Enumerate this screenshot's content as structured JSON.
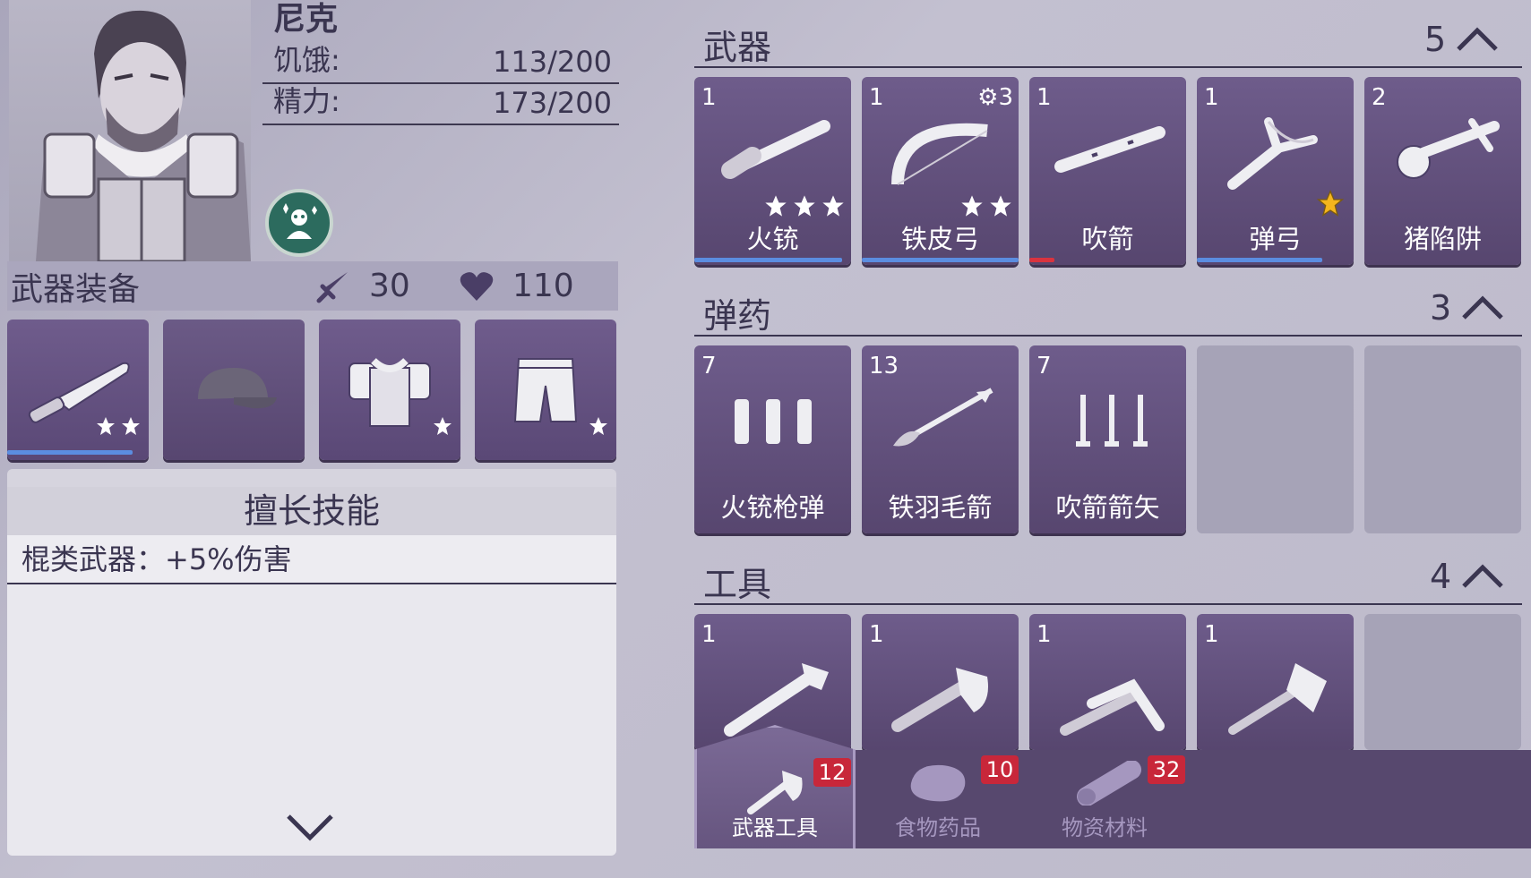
{
  "character": {
    "name": "尼克",
    "stats": [
      {
        "label": "饥饿:",
        "value": "113/200"
      },
      {
        "label": "精力:",
        "value": "173/200"
      }
    ],
    "perk_icon": "perk-badge-icon"
  },
  "equipment": {
    "title": "武器装备",
    "attack": "30",
    "health": "110",
    "slots": [
      {
        "icon": "machete-icon",
        "stars": 2,
        "durability": 0.9
      },
      {
        "icon": "cap-icon",
        "empty": true
      },
      {
        "icon": "armor-vest-icon",
        "stars": 1
      },
      {
        "icon": "shorts-icon",
        "stars": 1
      }
    ]
  },
  "skills": {
    "title": "擅长技能",
    "items": [
      "棍类武器：+5%伤害"
    ]
  },
  "inventory": {
    "sections": [
      {
        "title": "武器",
        "count": "5",
        "items": [
          {
            "qty": "1",
            "name": "火铳",
            "stars": 3,
            "durability": 0.95,
            "bar_color": "#5b8de0"
          },
          {
            "qty": "1",
            "name": "铁皮弓",
            "stars": 2,
            "gear": "3",
            "durability": 1.0,
            "bar_color": "#5b8de0"
          },
          {
            "qty": "1",
            "name": "吹箭",
            "durability": 0.15,
            "bar_color": "#d9333f"
          },
          {
            "qty": "1",
            "name": "弹弓",
            "gold_star": true,
            "durability": 0.8,
            "bar_color": "#5b8de0"
          },
          {
            "qty": "2",
            "name": "猪陷阱"
          }
        ]
      },
      {
        "title": "弹药",
        "count": "3",
        "items": [
          {
            "qty": "7",
            "name": "火铳枪弹"
          },
          {
            "qty": "13",
            "name": "铁羽毛箭"
          },
          {
            "qty": "7",
            "name": "吹箭箭矢"
          }
        ]
      },
      {
        "title": "工具",
        "count": "4",
        "items": [
          {
            "qty": "1",
            "name": "wrench"
          },
          {
            "qty": "1",
            "name": "axe"
          },
          {
            "qty": "1",
            "name": "pickaxe"
          },
          {
            "qty": "1",
            "name": "hammer"
          }
        ]
      }
    ]
  },
  "tabs": [
    {
      "label": "武器工具",
      "badge": "12",
      "active": true
    },
    {
      "label": "食物药品",
      "badge": "10"
    },
    {
      "label": "物资材料",
      "badge": "32"
    }
  ]
}
